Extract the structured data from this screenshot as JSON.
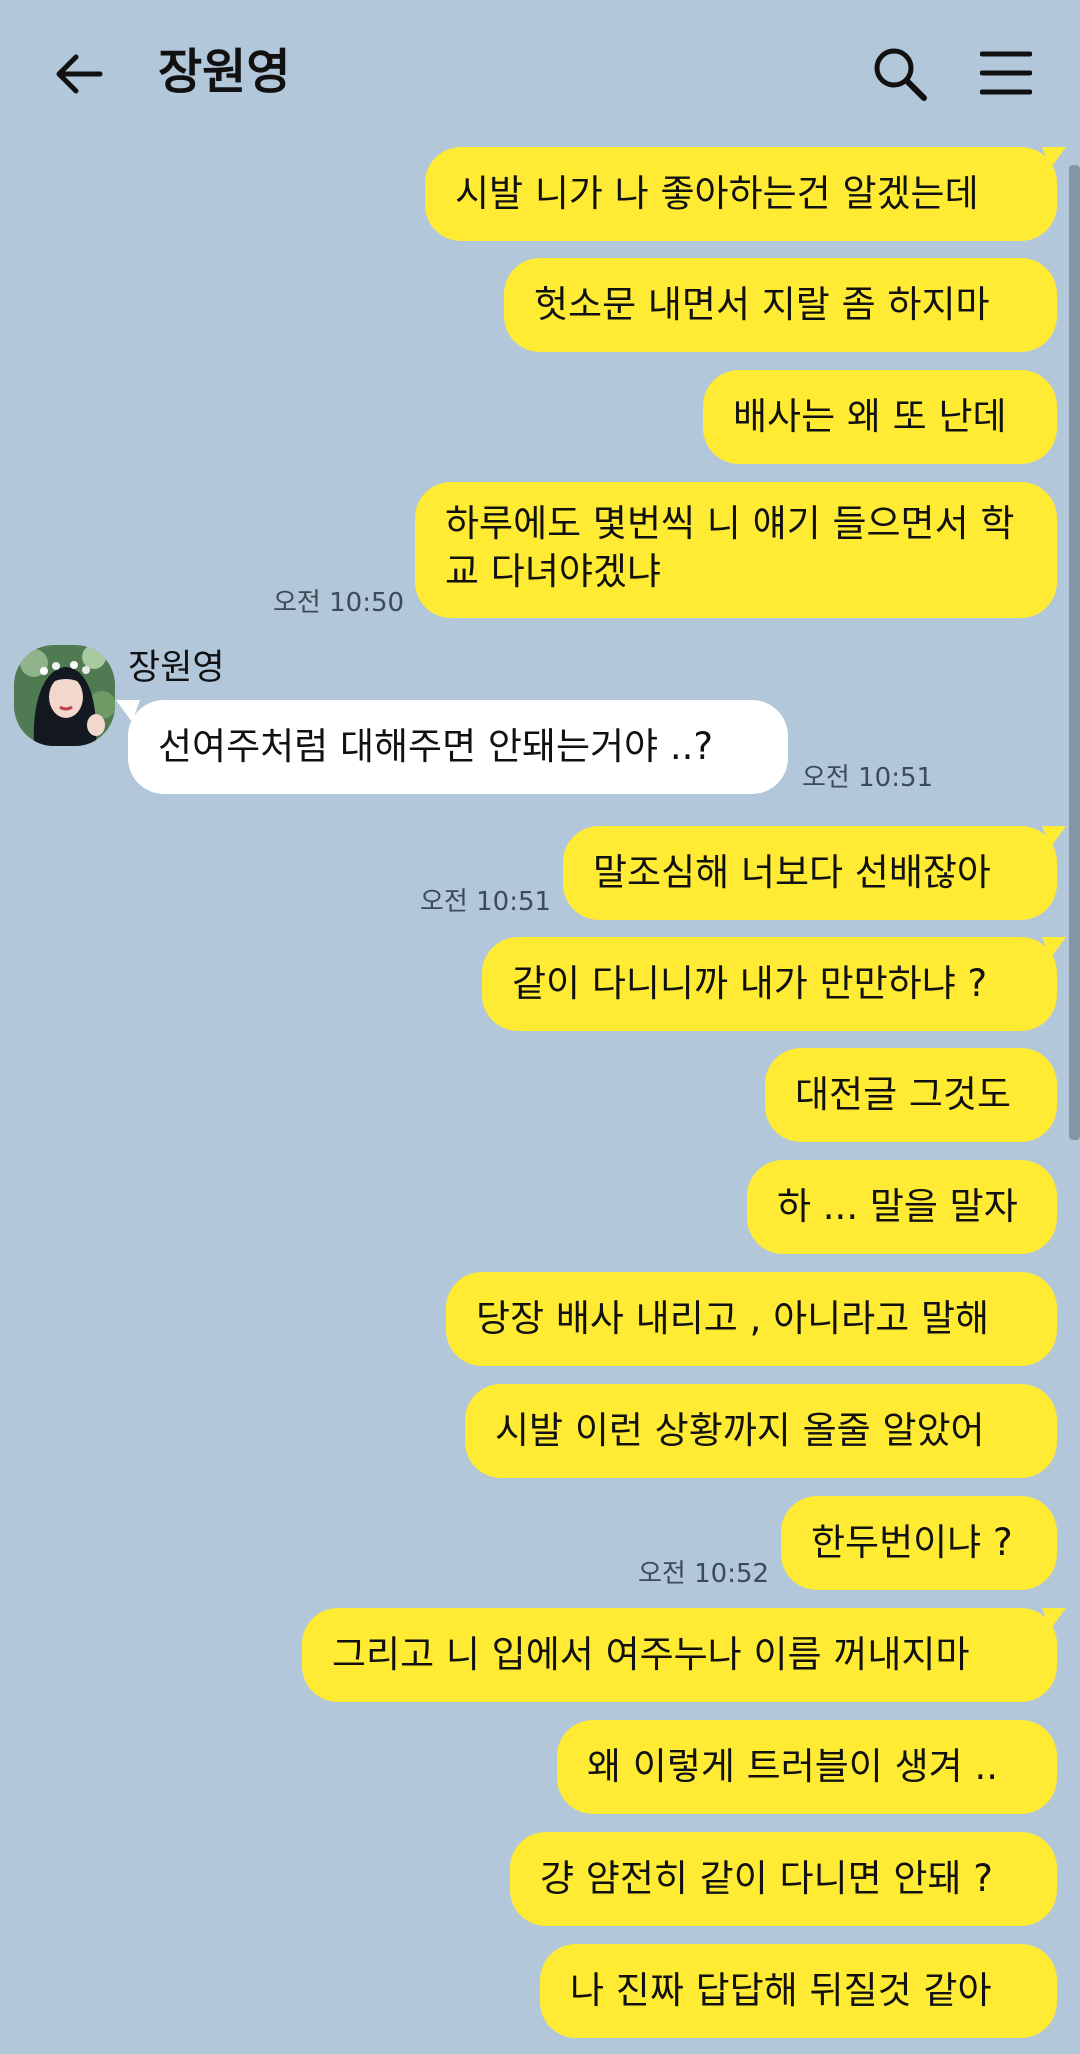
{
  "header": {
    "title": "장원영",
    "back_icon": "back-arrow-icon",
    "search_icon": "search-icon",
    "menu_icon": "menu-icon"
  },
  "colors": {
    "background": "#b2c7da",
    "my_bubble": "#ffeb33",
    "other_bubble": "#ffffff"
  },
  "messages": [
    {
      "from": "me",
      "text": "시발 니가 나 좋아하는건 알겠는데"
    },
    {
      "from": "me",
      "text": "헛소문 내면서 지랄 좀 하지마"
    },
    {
      "from": "me",
      "text": "배사는 왜 또 난데"
    },
    {
      "from": "me",
      "text": "하루에도 몇번씩 니 얘기 들으면서 학교 다녀야겠냐",
      "time": "오전 10:50"
    },
    {
      "from": "other",
      "sender": "장원영",
      "text": "선여주처럼 대해주면 안돼는거야 ..?",
      "time": "오전 10:51"
    },
    {
      "from": "me",
      "text": "말조심해 너보다 선배잖아",
      "time": "오전 10:51"
    },
    {
      "from": "me",
      "text": "같이 다니니까 내가 만만하냐 ?"
    },
    {
      "from": "me",
      "text": "대전글 그것도"
    },
    {
      "from": "me",
      "text": "하 ... 말을 말자"
    },
    {
      "from": "me",
      "text": "당장 배사 내리고 , 아니라고 말해"
    },
    {
      "from": "me",
      "text": "시발 이런 상황까지 올줄 알았어"
    },
    {
      "from": "me",
      "text": "한두번이냐 ?",
      "time": "오전 10:52"
    },
    {
      "from": "me",
      "text": "그리고 니 입에서 여주누나 이름 꺼내지마"
    },
    {
      "from": "me",
      "text": "왜 이렇게 트러블이 생겨 .."
    },
    {
      "from": "me",
      "text": "걍 얌전히 같이 다니면 안돼 ?"
    },
    {
      "from": "me",
      "text": "나 진짜 답답해 뒤질것 같아"
    }
  ]
}
